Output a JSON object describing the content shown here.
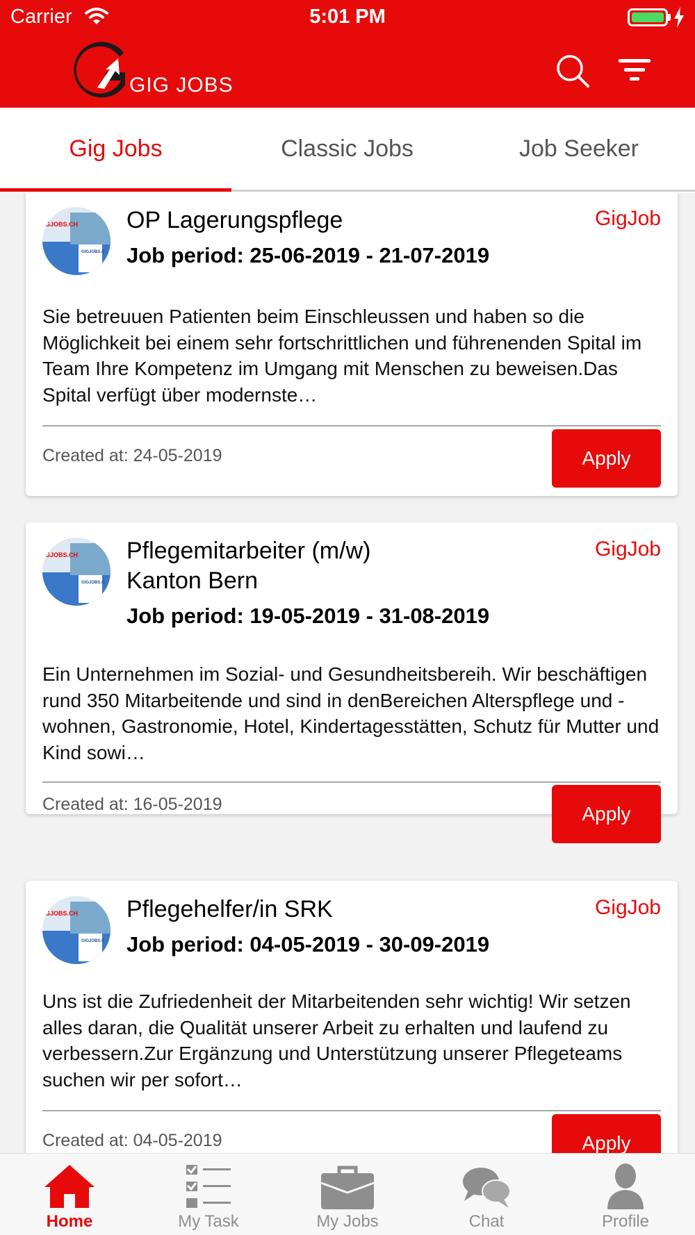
{
  "status_bar": {
    "carrier": "Carrier",
    "time": "5:01 PM"
  },
  "header": {
    "logo_text": "GIG JOBS"
  },
  "tabs": [
    {
      "label": "Gig Jobs",
      "active": true
    },
    {
      "label": "Classic Jobs",
      "active": false
    },
    {
      "label": "Job Seeker",
      "active": false
    }
  ],
  "jobs": [
    {
      "title": "OP Lagerungspflege",
      "period": "Job period: 25-06-2019 - 21-07-2019",
      "type": "GigJob",
      "description": "Sie betreuuen Patienten beim Einschleussen und haben so die Möglichkeit bei einem sehr fortschrittlichen und führenenden Spital im Team Ihre Kompetenz im Umgang mit Menschen zu beweisen.Das Spital verfügt über modernste…",
      "created": "Created at: 24-05-2019",
      "apply_label": "Apply"
    },
    {
      "title": "Pflegemitarbeiter (m/w)\nKanton Bern",
      "period": "Job period: 19-05-2019 - 31-08-2019",
      "type": "GigJob",
      "description": "Ein Unternehmen im Sozial- und Gesundheitsbereih. Wir beschäftigen rund 350 Mitarbeitende und sind in denBereichen Alterspflege und -wohnen, Gastronomie, Hotel, Kindertagesstätten, Schutz für Mutter und Kind sowi…",
      "created": "Created at: 16-05-2019",
      "apply_label": "Apply"
    },
    {
      "title": "Pflegehelfer/in SRK",
      "period": "Job period: 04-05-2019 - 30-09-2019",
      "type": "GigJob",
      "description": "Uns ist die Zufriedenheit der Mitarbeitenden sehr wichtig! Wir setzen alles daran, die Qualität unserer Arbeit zu erhalten und laufend zu verbessern.Zur Ergänzung und Unterstützung unserer Pflegeteams suchen wir per sofort…",
      "created": "Created at: 04-05-2019",
      "apply_label": "Apply"
    }
  ],
  "bottom_nav": [
    {
      "label": "Home",
      "icon": "home-icon",
      "active": true
    },
    {
      "label": "My Task",
      "icon": "checklist-icon",
      "active": false
    },
    {
      "label": "My Jobs",
      "icon": "briefcase-icon",
      "active": false
    },
    {
      "label": "Chat",
      "icon": "chat-bubbles-icon",
      "active": false
    },
    {
      "label": "Profile",
      "icon": "person-icon",
      "active": false
    }
  ],
  "colors": {
    "accent": "#e70a0a",
    "nav_inactive": "#8e8e8e",
    "battery": "#4cd964"
  }
}
